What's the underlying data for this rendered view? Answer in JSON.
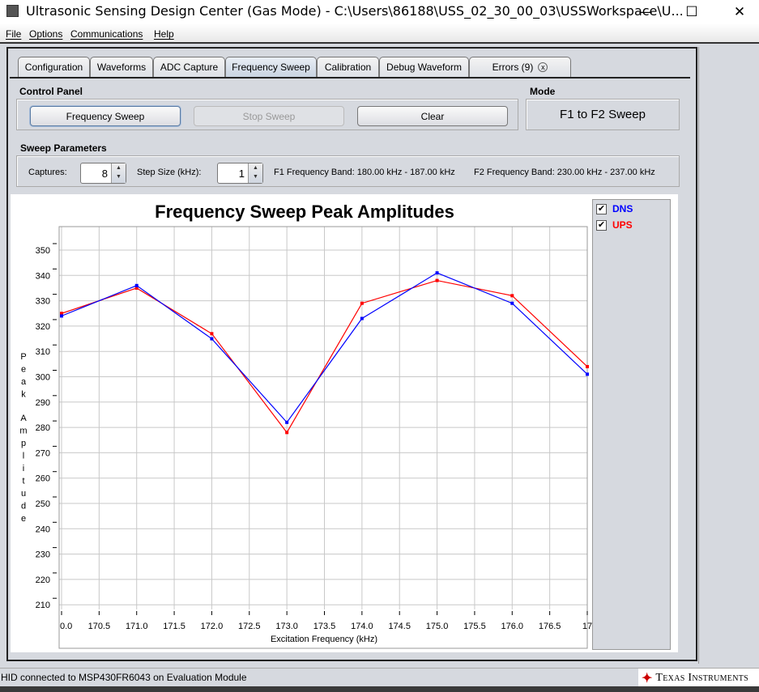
{
  "window": {
    "title": "Ultrasonic Sensing Design Center (Gas Mode) - C:\\Users\\86188\\USS_02_30_00_03\\USSWorkspace\\U...",
    "minimize": "—",
    "maximize": "☐",
    "close": "✕"
  },
  "menu": [
    "File",
    "Options",
    "Communications",
    "Help"
  ],
  "tabs": [
    {
      "label": "Configuration"
    },
    {
      "label": "Waveforms"
    },
    {
      "label": "ADC Capture"
    },
    {
      "label": "Frequency Sweep",
      "active": true
    },
    {
      "label": "Calibration"
    },
    {
      "label": "Debug Waveform"
    },
    {
      "label": "Errors (9)",
      "close": "x"
    }
  ],
  "control_panel": {
    "title": "Control Panel",
    "frequency_sweep": "Frequency Sweep",
    "stop_sweep": "Stop Sweep",
    "clear": "Clear"
  },
  "mode": {
    "title": "Mode",
    "value": "F1 to F2 Sweep"
  },
  "sweep_parameters": {
    "title": "Sweep Parameters",
    "captures_label": "Captures:",
    "captures_value": "8",
    "step_label": "Step Size (kHz):",
    "step_value": "1",
    "f1_band": "F1 Frequency Band: 180.00 kHz - 187.00 kHz",
    "f2_band": "F2 Frequency Band: 230.00 kHz - 237.00 kHz"
  },
  "legend": [
    {
      "label": "DNS",
      "checked": true,
      "color": "#0000ff"
    },
    {
      "label": "UPS",
      "checked": true,
      "color": "#ff0000"
    }
  ],
  "chart_data": {
    "type": "line",
    "title": "Frequency Sweep Peak Amplitudes",
    "xlabel": "Excitation Frequency (kHz)",
    "ylabel": "Peak Amplitude",
    "x": [
      170.0,
      171.0,
      172.0,
      173.0,
      174.0,
      175.0,
      176.0,
      177.0
    ],
    "xlim": [
      170.0,
      177.0
    ],
    "ylim": [
      210,
      350
    ],
    "xticks": [
      "0.0",
      "170.5",
      "171.0",
      "171.5",
      "172.0",
      "172.5",
      "173.0",
      "173.5",
      "174.0",
      "174.5",
      "175.0",
      "175.5",
      "176.0",
      "176.5",
      "17"
    ],
    "yticks": [
      "350",
      "340",
      "330",
      "320",
      "310",
      "300",
      "290",
      "280",
      "270",
      "260",
      "250",
      "240",
      "230",
      "220",
      "210"
    ],
    "grid": true,
    "legend_placement": "right",
    "series": [
      {
        "name": "DNS",
        "color": "#0000ff",
        "values": [
          324,
          336,
          315,
          282,
          323,
          341,
          329,
          301
        ]
      },
      {
        "name": "UPS",
        "color": "#ff0000",
        "values": [
          325,
          335,
          317,
          278,
          329,
          338,
          332,
          304
        ]
      }
    ]
  },
  "status": {
    "message": "HID connected to MSP430FR6043 on Evaluation Module",
    "logo": "Texas Instruments"
  }
}
